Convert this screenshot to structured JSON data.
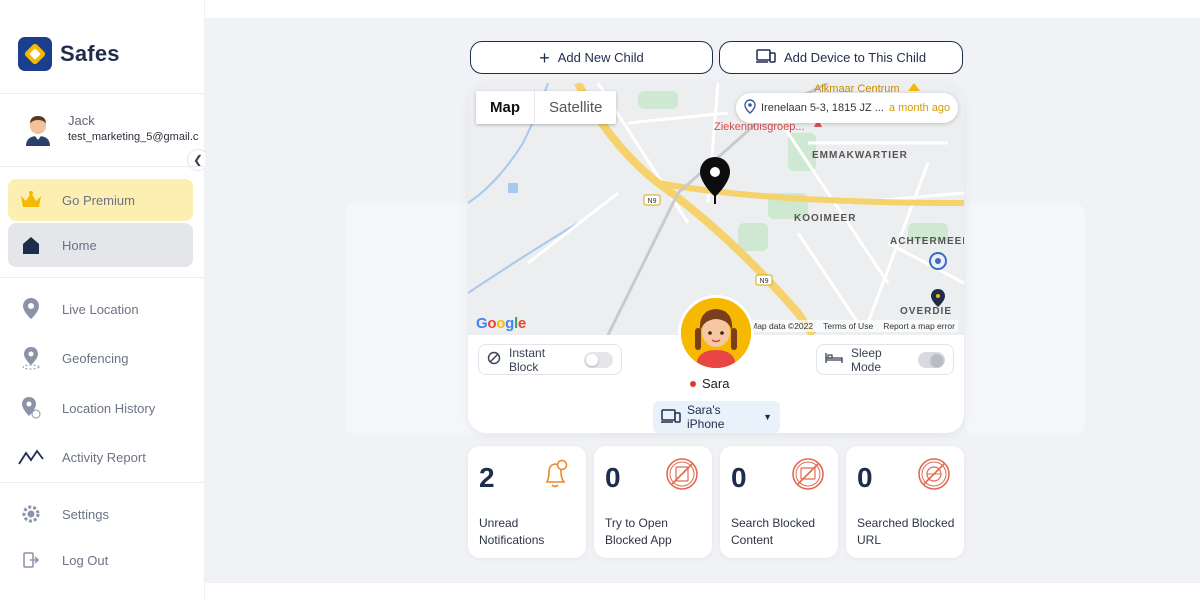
{
  "app": {
    "name": "Safes"
  },
  "profile": {
    "name": "Jack",
    "email": "test_marketing_5@gmail.c"
  },
  "nav": {
    "premium": "Go Premium",
    "home": "Home",
    "live_location": "Live Location",
    "geofencing": "Geofencing",
    "location_history": "Location History",
    "activity_report": "Activity Report",
    "settings": "Settings",
    "logout": "Log Out"
  },
  "actions": {
    "add_child": "Add New Child",
    "add_device": "Add Device to This Child"
  },
  "map": {
    "tab_map": "Map",
    "tab_satellite": "Satellite",
    "address": "Irenelaan 5-3, 1815 JZ ...",
    "address_age": "a month ago",
    "provider": "Google",
    "map_data": "Map data ©2022",
    "terms": "Terms of Use",
    "report": "Report a map error",
    "labels": {
      "alkmaar": "Alkmaar Centrum",
      "hospital": "Ziekennuisgroep...",
      "emmakwartier": "EMMAKWARTIER",
      "kooimeer": "KOOIMEER",
      "achtermeer": "ACHTERMEER",
      "overdie": "OVERDIE",
      "road1": "N9",
      "road2": "N9"
    }
  },
  "child": {
    "name": "Sara",
    "instant_block": "Instant Block",
    "sleep_mode": "Sleep Mode",
    "device": "Sara's iPhone"
  },
  "stats": [
    {
      "value": "2",
      "label": "Unread Notifications"
    },
    {
      "value": "0",
      "label": "Try to Open Blocked App"
    },
    {
      "value": "0",
      "label": "Search Blocked Content"
    },
    {
      "value": "0",
      "label": "Searched Blocked URL"
    }
  ],
  "colors": {
    "primary": "#1f2d4d",
    "premium_bg": "#fdefb2",
    "accent": "#f6b800",
    "bell": "#e98a2c",
    "blocked": "#e06a52"
  }
}
